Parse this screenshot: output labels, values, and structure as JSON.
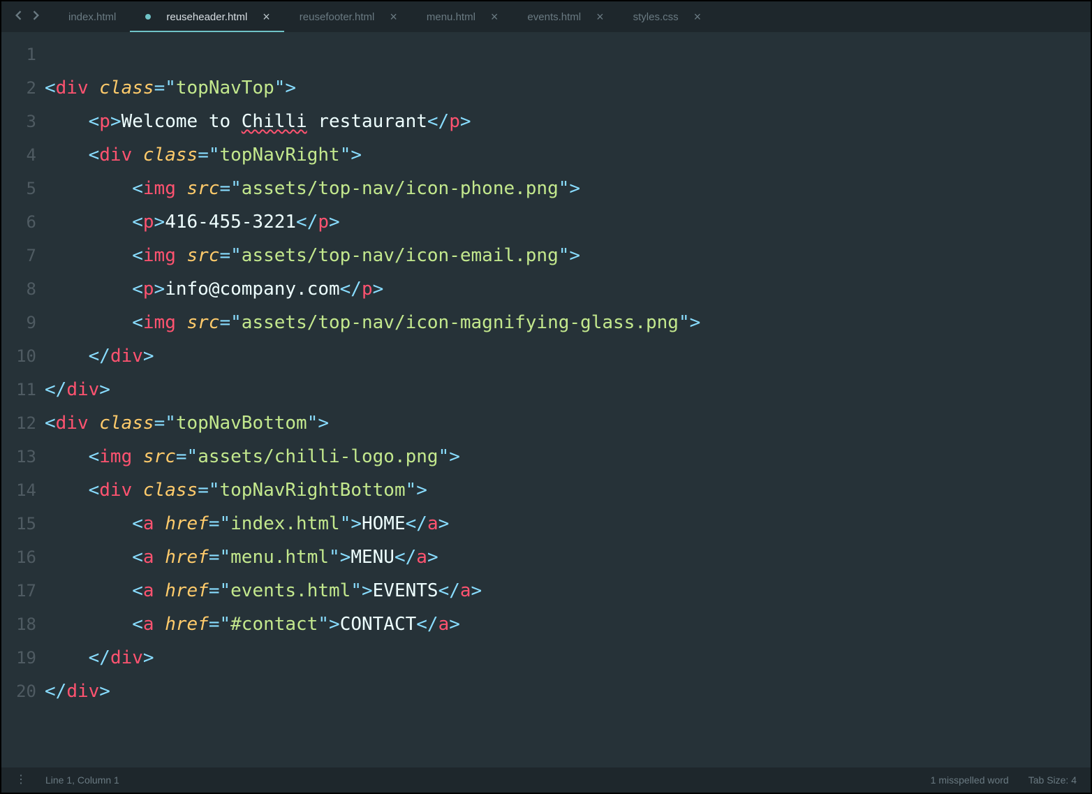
{
  "tabs": [
    {
      "label": "index.html",
      "active": false,
      "dirty": false,
      "closable": false
    },
    {
      "label": "reuseheader.html",
      "active": true,
      "dirty": true,
      "closable": true
    },
    {
      "label": "reusefooter.html",
      "active": false,
      "dirty": false,
      "closable": true
    },
    {
      "label": "menu.html",
      "active": false,
      "dirty": false,
      "closable": true
    },
    {
      "label": "events.html",
      "active": false,
      "dirty": false,
      "closable": true
    },
    {
      "label": "styles.css",
      "active": false,
      "dirty": false,
      "closable": true
    }
  ],
  "code": {
    "lines": [
      {
        "n": 1,
        "indent": 0,
        "tokens": []
      },
      {
        "n": 2,
        "indent": 0,
        "tokens": [
          {
            "t": "punc",
            "v": "<"
          },
          {
            "t": "tagn",
            "v": "div"
          },
          {
            "t": "txt",
            "v": " "
          },
          {
            "t": "attr",
            "v": "class"
          },
          {
            "t": "punc",
            "v": "="
          },
          {
            "t": "punc",
            "v": "\""
          },
          {
            "t": "str",
            "v": "topNavTop"
          },
          {
            "t": "punc",
            "v": "\""
          },
          {
            "t": "punc",
            "v": ">"
          }
        ]
      },
      {
        "n": 3,
        "indent": 1,
        "tokens": [
          {
            "t": "punc",
            "v": "<"
          },
          {
            "t": "tagn",
            "v": "p"
          },
          {
            "t": "punc",
            "v": ">"
          },
          {
            "t": "txt",
            "v": "Welcome to "
          },
          {
            "t": "txt",
            "v": "Chilli",
            "spell": true
          },
          {
            "t": "txt",
            "v": " restaurant"
          },
          {
            "t": "punc",
            "v": "</"
          },
          {
            "t": "tagn",
            "v": "p"
          },
          {
            "t": "punc",
            "v": ">"
          }
        ]
      },
      {
        "n": 4,
        "indent": 1,
        "tokens": [
          {
            "t": "punc",
            "v": "<"
          },
          {
            "t": "tagn",
            "v": "div"
          },
          {
            "t": "txt",
            "v": " "
          },
          {
            "t": "attr",
            "v": "class"
          },
          {
            "t": "punc",
            "v": "="
          },
          {
            "t": "punc",
            "v": "\""
          },
          {
            "t": "str",
            "v": "topNavRight"
          },
          {
            "t": "punc",
            "v": "\""
          },
          {
            "t": "punc",
            "v": ">"
          }
        ]
      },
      {
        "n": 5,
        "indent": 2,
        "tokens": [
          {
            "t": "punc",
            "v": "<"
          },
          {
            "t": "tagn",
            "v": "img"
          },
          {
            "t": "txt",
            "v": " "
          },
          {
            "t": "attr",
            "v": "src"
          },
          {
            "t": "punc",
            "v": "="
          },
          {
            "t": "punc",
            "v": "\""
          },
          {
            "t": "str",
            "v": "assets/top-nav/icon-phone.png"
          },
          {
            "t": "punc",
            "v": "\""
          },
          {
            "t": "punc",
            "v": ">"
          }
        ]
      },
      {
        "n": 6,
        "indent": 2,
        "tokens": [
          {
            "t": "punc",
            "v": "<"
          },
          {
            "t": "tagn",
            "v": "p"
          },
          {
            "t": "punc",
            "v": ">"
          },
          {
            "t": "txt",
            "v": "416-455-3221"
          },
          {
            "t": "punc",
            "v": "</"
          },
          {
            "t": "tagn",
            "v": "p"
          },
          {
            "t": "punc",
            "v": ">"
          }
        ]
      },
      {
        "n": 7,
        "indent": 2,
        "tokens": [
          {
            "t": "punc",
            "v": "<"
          },
          {
            "t": "tagn",
            "v": "img"
          },
          {
            "t": "txt",
            "v": " "
          },
          {
            "t": "attr",
            "v": "src"
          },
          {
            "t": "punc",
            "v": "="
          },
          {
            "t": "punc",
            "v": "\""
          },
          {
            "t": "str",
            "v": "assets/top-nav/icon-email.png"
          },
          {
            "t": "punc",
            "v": "\""
          },
          {
            "t": "punc",
            "v": ">"
          }
        ]
      },
      {
        "n": 8,
        "indent": 2,
        "tokens": [
          {
            "t": "punc",
            "v": "<"
          },
          {
            "t": "tagn",
            "v": "p"
          },
          {
            "t": "punc",
            "v": ">"
          },
          {
            "t": "txt",
            "v": "info@company.com"
          },
          {
            "t": "punc",
            "v": "</"
          },
          {
            "t": "tagn",
            "v": "p"
          },
          {
            "t": "punc",
            "v": ">"
          }
        ]
      },
      {
        "n": 9,
        "indent": 2,
        "tokens": [
          {
            "t": "punc",
            "v": "<"
          },
          {
            "t": "tagn",
            "v": "img"
          },
          {
            "t": "txt",
            "v": " "
          },
          {
            "t": "attr",
            "v": "src"
          },
          {
            "t": "punc",
            "v": "="
          },
          {
            "t": "punc",
            "v": "\""
          },
          {
            "t": "str",
            "v": "assets/top-nav/icon-magnifying-glass.png"
          },
          {
            "t": "punc",
            "v": "\""
          },
          {
            "t": "punc",
            "v": ">"
          }
        ]
      },
      {
        "n": 10,
        "indent": 1,
        "tokens": [
          {
            "t": "punc",
            "v": "</"
          },
          {
            "t": "tagn",
            "v": "div"
          },
          {
            "t": "punc",
            "v": ">"
          }
        ]
      },
      {
        "n": 11,
        "indent": 0,
        "tokens": [
          {
            "t": "punc",
            "v": "</"
          },
          {
            "t": "tagn",
            "v": "div"
          },
          {
            "t": "punc",
            "v": ">"
          }
        ]
      },
      {
        "n": 12,
        "indent": 0,
        "tokens": [
          {
            "t": "punc",
            "v": "<"
          },
          {
            "t": "tagn",
            "v": "div"
          },
          {
            "t": "txt",
            "v": " "
          },
          {
            "t": "attr",
            "v": "class"
          },
          {
            "t": "punc",
            "v": "="
          },
          {
            "t": "punc",
            "v": "\""
          },
          {
            "t": "str",
            "v": "topNavBottom"
          },
          {
            "t": "punc",
            "v": "\""
          },
          {
            "t": "punc",
            "v": ">"
          }
        ]
      },
      {
        "n": 13,
        "indent": 1,
        "tokens": [
          {
            "t": "punc",
            "v": "<"
          },
          {
            "t": "tagn",
            "v": "img"
          },
          {
            "t": "txt",
            "v": " "
          },
          {
            "t": "attr",
            "v": "src"
          },
          {
            "t": "punc",
            "v": "="
          },
          {
            "t": "punc",
            "v": "\""
          },
          {
            "t": "str",
            "v": "assets/chilli-logo.png"
          },
          {
            "t": "punc",
            "v": "\""
          },
          {
            "t": "punc",
            "v": ">"
          }
        ]
      },
      {
        "n": 14,
        "indent": 1,
        "tokens": [
          {
            "t": "punc",
            "v": "<"
          },
          {
            "t": "tagn",
            "v": "div"
          },
          {
            "t": "txt",
            "v": " "
          },
          {
            "t": "attr",
            "v": "class"
          },
          {
            "t": "punc",
            "v": "="
          },
          {
            "t": "punc",
            "v": "\""
          },
          {
            "t": "str",
            "v": "topNavRightBottom"
          },
          {
            "t": "punc",
            "v": "\""
          },
          {
            "t": "punc",
            "v": ">"
          }
        ]
      },
      {
        "n": 15,
        "indent": 2,
        "tokens": [
          {
            "t": "punc",
            "v": "<"
          },
          {
            "t": "tagn",
            "v": "a"
          },
          {
            "t": "txt",
            "v": " "
          },
          {
            "t": "attr",
            "v": "href"
          },
          {
            "t": "punc",
            "v": "="
          },
          {
            "t": "punc",
            "v": "\""
          },
          {
            "t": "str",
            "v": "index.html"
          },
          {
            "t": "punc",
            "v": "\""
          },
          {
            "t": "punc",
            "v": ">"
          },
          {
            "t": "txt",
            "v": "HOME"
          },
          {
            "t": "punc",
            "v": "</"
          },
          {
            "t": "tagn",
            "v": "a"
          },
          {
            "t": "punc",
            "v": ">"
          }
        ]
      },
      {
        "n": 16,
        "indent": 2,
        "tokens": [
          {
            "t": "punc",
            "v": "<"
          },
          {
            "t": "tagn",
            "v": "a"
          },
          {
            "t": "txt",
            "v": " "
          },
          {
            "t": "attr",
            "v": "href"
          },
          {
            "t": "punc",
            "v": "="
          },
          {
            "t": "punc",
            "v": "\""
          },
          {
            "t": "str",
            "v": "menu.html"
          },
          {
            "t": "punc",
            "v": "\""
          },
          {
            "t": "punc",
            "v": ">"
          },
          {
            "t": "txt",
            "v": "MENU"
          },
          {
            "t": "punc",
            "v": "</"
          },
          {
            "t": "tagn",
            "v": "a"
          },
          {
            "t": "punc",
            "v": ">"
          }
        ]
      },
      {
        "n": 17,
        "indent": 2,
        "tokens": [
          {
            "t": "punc",
            "v": "<"
          },
          {
            "t": "tagn",
            "v": "a"
          },
          {
            "t": "txt",
            "v": " "
          },
          {
            "t": "attr",
            "v": "href"
          },
          {
            "t": "punc",
            "v": "="
          },
          {
            "t": "punc",
            "v": "\""
          },
          {
            "t": "str",
            "v": "events.html"
          },
          {
            "t": "punc",
            "v": "\""
          },
          {
            "t": "punc",
            "v": ">"
          },
          {
            "t": "txt",
            "v": "EVENTS"
          },
          {
            "t": "punc",
            "v": "</"
          },
          {
            "t": "tagn",
            "v": "a"
          },
          {
            "t": "punc",
            "v": ">"
          }
        ]
      },
      {
        "n": 18,
        "indent": 2,
        "tokens": [
          {
            "t": "punc",
            "v": "<"
          },
          {
            "t": "tagn",
            "v": "a"
          },
          {
            "t": "txt",
            "v": " "
          },
          {
            "t": "attr",
            "v": "href"
          },
          {
            "t": "punc",
            "v": "="
          },
          {
            "t": "punc",
            "v": "\""
          },
          {
            "t": "str",
            "v": "#contact"
          },
          {
            "t": "punc",
            "v": "\""
          },
          {
            "t": "punc",
            "v": ">"
          },
          {
            "t": "txt",
            "v": "CONTACT"
          },
          {
            "t": "punc",
            "v": "</"
          },
          {
            "t": "tagn",
            "v": "a"
          },
          {
            "t": "punc",
            "v": ">"
          }
        ]
      },
      {
        "n": 19,
        "indent": 1,
        "tokens": [
          {
            "t": "punc",
            "v": "</"
          },
          {
            "t": "tagn",
            "v": "div"
          },
          {
            "t": "punc",
            "v": ">"
          }
        ]
      },
      {
        "n": 20,
        "indent": 0,
        "tokens": [
          {
            "t": "punc",
            "v": "</"
          },
          {
            "t": "tagn",
            "v": "div"
          },
          {
            "t": "punc",
            "v": ">"
          }
        ]
      }
    ]
  },
  "status": {
    "cursor": "Line 1, Column 1",
    "spell": "1 misspelled word",
    "tabsize": "Tab Size: 4"
  },
  "icons": {
    "close": "×",
    "dots": "⋮"
  }
}
